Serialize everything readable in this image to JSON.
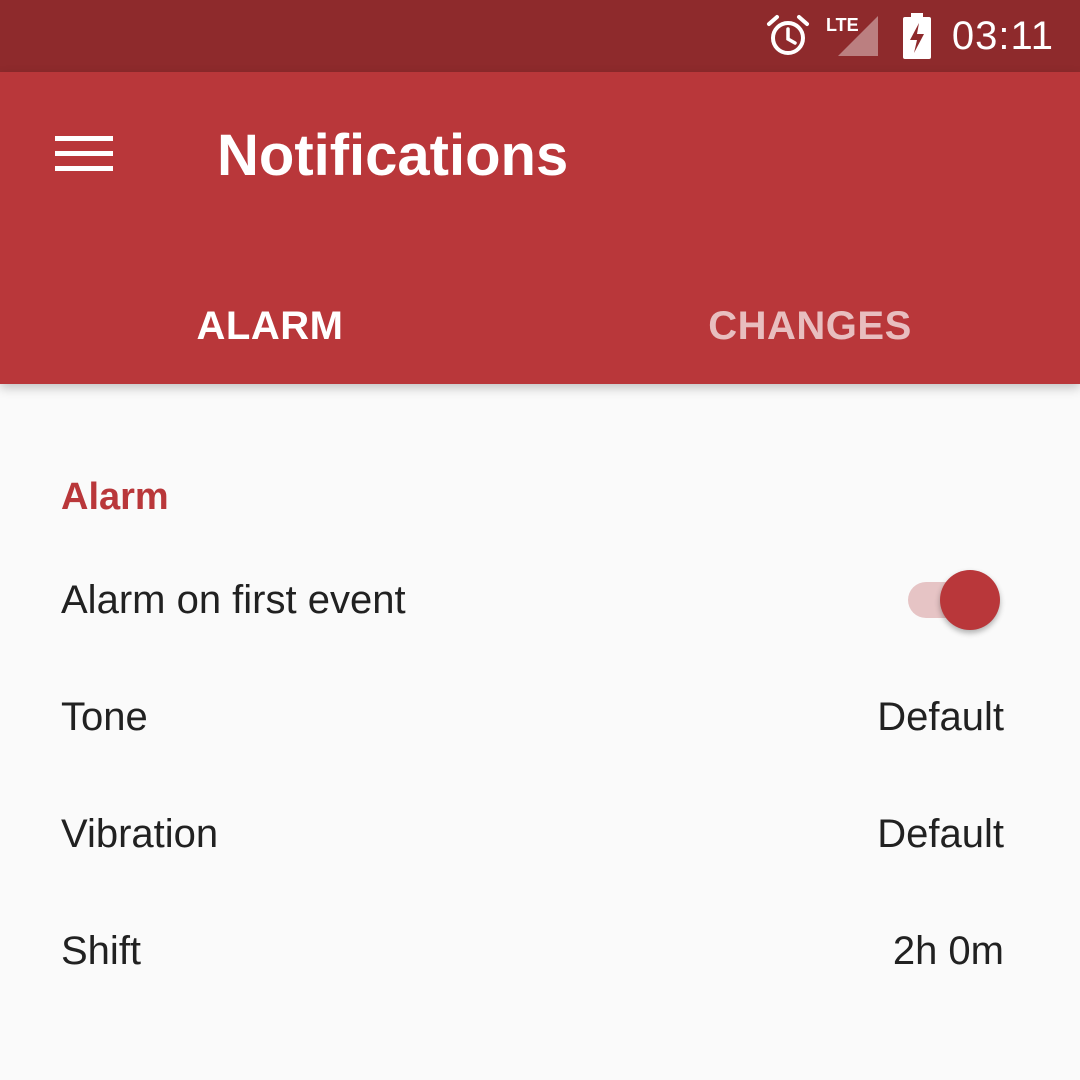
{
  "status_bar": {
    "time": "03:11",
    "network_label": "LTE",
    "icons": [
      "alarm-clock-icon",
      "lte-signal-icon",
      "battery-charging-icon"
    ]
  },
  "app_bar": {
    "title": "Notifications",
    "menu_icon": "hamburger-menu-icon",
    "tabs": [
      {
        "label": "ALARM",
        "active": true
      },
      {
        "label": "CHANGES",
        "active": false
      }
    ]
  },
  "settings": {
    "section_title": "Alarm",
    "rows": [
      {
        "label": "Alarm on first event",
        "type": "toggle",
        "value": true
      },
      {
        "label": "Tone",
        "value": "Default"
      },
      {
        "label": "Vibration",
        "value": "Default"
      },
      {
        "label": "Shift",
        "value": "2h 0m"
      }
    ]
  },
  "colors": {
    "status_bar": "#8e2a2c",
    "primary": "#b9373a",
    "background": "#fafafa",
    "text": "#212121"
  }
}
